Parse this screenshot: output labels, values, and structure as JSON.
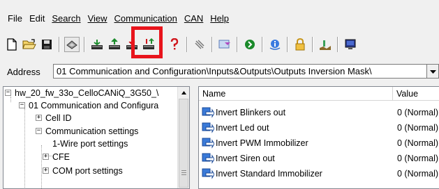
{
  "menu": {
    "items": [
      {
        "label": "File"
      },
      {
        "label": "Edit"
      },
      {
        "label": "Search"
      },
      {
        "label": "View"
      },
      {
        "label": "Communication"
      },
      {
        "label": "CAN"
      },
      {
        "label": "Help"
      }
    ]
  },
  "toolbar": {
    "icons": [
      "new-document-icon",
      "open-folder-icon",
      "save-disk-icon",
      "device-icon",
      "read-icon",
      "upload-icon",
      "download-icon",
      "write-all-icon",
      "help-icon",
      "refresh-icon",
      "send-icon",
      "stop-icon",
      "info-icon",
      "lock-icon",
      "chart-icon",
      "terminal-icon"
    ],
    "highlight_color": "#e8141c"
  },
  "address": {
    "label": "Address",
    "value": "01 Communication and Configuration\\Inputs&Outputs\\Outputs Inversion Mask\\"
  },
  "tree": {
    "nodes": [
      {
        "label": "hw_20_fw_33o_CelloCANiQ_3G50_\\"
      },
      {
        "label": "01 Communication and Configura"
      },
      {
        "label": "Cell ID"
      },
      {
        "label": "Communication settings"
      },
      {
        "label": "1-Wire port settings"
      },
      {
        "label": "CFE"
      },
      {
        "label": "COM port settings"
      }
    ]
  },
  "list": {
    "headers": {
      "name": "Name",
      "value": "Value"
    },
    "rows": [
      {
        "name": "Invert Blinkers out",
        "value": "0 (Normal)"
      },
      {
        "name": "Invert Led out",
        "value": "0 (Normal)"
      },
      {
        "name": "Invert PWM Immobilizer",
        "value": "0 (Normal)"
      },
      {
        "name": "Invert Siren out",
        "value": "0 (Normal)"
      },
      {
        "name": "Invert Standard Immobilizer",
        "value": "0 (Normal)"
      }
    ]
  }
}
